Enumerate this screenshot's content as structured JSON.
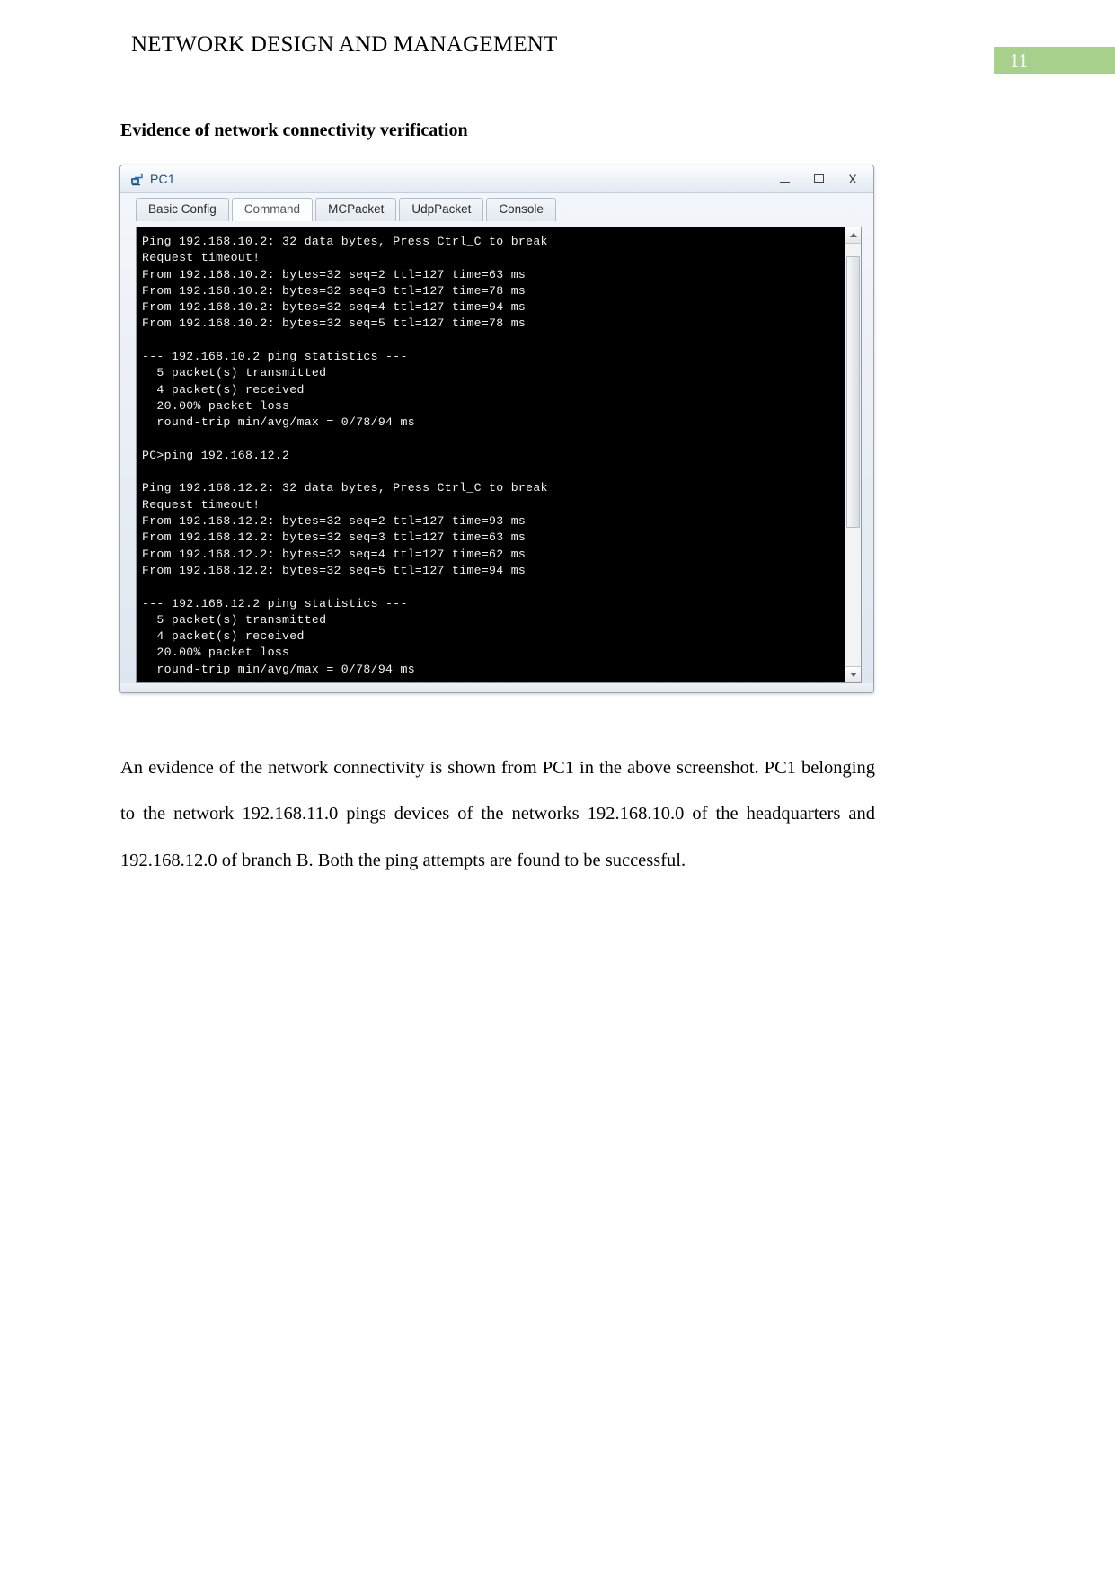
{
  "header": {
    "title": "NETWORK DESIGN AND MANAGEMENT",
    "page_number": "11",
    "band_color": "#a8d08d"
  },
  "section": {
    "heading": "Evidence of network connectivity verification"
  },
  "app_window": {
    "title": "PC1",
    "icon": "pc-device-icon",
    "controls": {
      "minimize": "–",
      "maximize": "❐",
      "close": "X"
    },
    "tabs": [
      {
        "label": "Basic Config",
        "active": false
      },
      {
        "label": "Command",
        "active": true
      },
      {
        "label": "MCPacket",
        "active": false
      },
      {
        "label": "UdpPacket",
        "active": false
      },
      {
        "label": "Console",
        "active": false
      }
    ],
    "terminal_lines": [
      "Ping 192.168.10.2: 32 data bytes, Press Ctrl_C to break",
      "Request timeout!",
      "From 192.168.10.2: bytes=32 seq=2 ttl=127 time=63 ms",
      "From 192.168.10.2: bytes=32 seq=3 ttl=127 time=78 ms",
      "From 192.168.10.2: bytes=32 seq=4 ttl=127 time=94 ms",
      "From 192.168.10.2: bytes=32 seq=5 ttl=127 time=78 ms",
      "",
      "--- 192.168.10.2 ping statistics ---",
      "  5 packet(s) transmitted",
      "  4 packet(s) received",
      "  20.00% packet loss",
      "  round-trip min/avg/max = 0/78/94 ms",
      "",
      "PC>ping 192.168.12.2",
      "",
      "Ping 192.168.12.2: 32 data bytes, Press Ctrl_C to break",
      "Request timeout!",
      "From 192.168.12.2: bytes=32 seq=2 ttl=127 time=93 ms",
      "From 192.168.12.2: bytes=32 seq=3 ttl=127 time=63 ms",
      "From 192.168.12.2: bytes=32 seq=4 ttl=127 time=62 ms",
      "From 192.168.12.2: bytes=32 seq=5 ttl=127 time=94 ms",
      "",
      "--- 192.168.12.2 ping statistics ---",
      "  5 packet(s) transmitted",
      "  4 packet(s) received",
      "  20.00% packet loss",
      "  round-trip min/avg/max = 0/78/94 ms"
    ]
  },
  "body": {
    "paragraph": "An evidence of the network connectivity is shown from PC1 in the above screenshot. PC1 belonging to the network 192.168.11.0 pings devices of the networks 192.168.10.0 of the headquarters and 192.168.12.0 of branch B. Both the ping attempts are found to be successful."
  }
}
